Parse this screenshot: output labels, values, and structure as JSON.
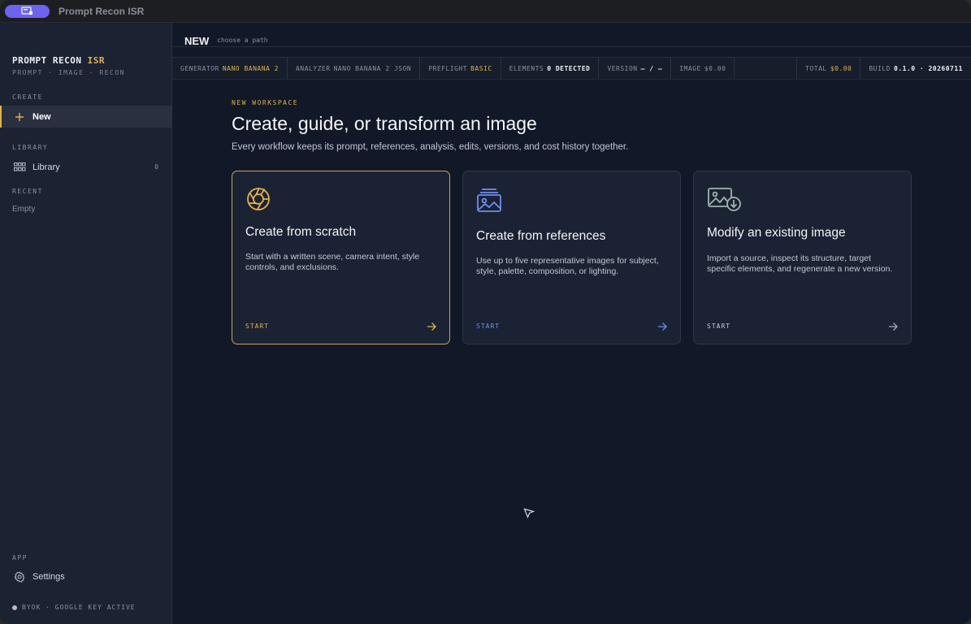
{
  "window": {
    "title": "Prompt Recon ISR"
  },
  "sidebar": {
    "brand_main": "PROMPT RECON",
    "brand_accent": "ISR",
    "brand_sub": "PROMPT · IMAGE · RECON",
    "create_label": "CREATE",
    "new_label": "New",
    "library_label": "LIBRARY",
    "library_item": "Library",
    "library_count": "0",
    "recent_label": "RECENT",
    "recent_empty": "Empty",
    "app_label": "APP",
    "settings_label": "Settings",
    "status": "BYOK · GOOGLE KEY ACTIVE"
  },
  "header": {
    "title": "NEW",
    "subtitle": "choose a path"
  },
  "statusbar": {
    "generator_label": "GENERATOR",
    "generator_value": "NANO BANANA 2",
    "analyzer_label": "ANALYZER",
    "analyzer_value": "NANO BANANA 2 JSON",
    "preflight_label": "PREFLIGHT",
    "preflight_value": "BASIC",
    "elements_label": "ELEMENTS",
    "elements_value": "0 DETECTED",
    "version_label": "VERSION",
    "version_value": "– / –",
    "image_label": "IMAGE",
    "image_value": "$0.00",
    "total_label": "TOTAL",
    "total_value": "$0.00",
    "build_label": "BUILD",
    "build_value": "0.1.0 · 20260711"
  },
  "hero": {
    "eyebrow": "NEW WORKSPACE",
    "title": "Create, guide, or transform an image",
    "subtitle": "Every workflow keeps its prompt, references, analysis, edits, versions, and cost history together."
  },
  "cards": [
    {
      "title": "Create from scratch",
      "desc": "Start with a written scene, camera intent, style controls, and exclusions.",
      "action": "START",
      "icon": "aperture-icon",
      "accent": "#e0b34a"
    },
    {
      "title": "Create from references",
      "desc": "Use up to five representative images for subject, style, palette, composition, or lighting.",
      "action": "START",
      "icon": "image-stack-icon",
      "accent": "#6e8ff0"
    },
    {
      "title": "Modify an existing image",
      "desc": "Import a source, inspect its structure, target specific elements, and regenerate a new version.",
      "action": "START",
      "icon": "image-download-icon",
      "accent": "#9fb4ad"
    }
  ]
}
